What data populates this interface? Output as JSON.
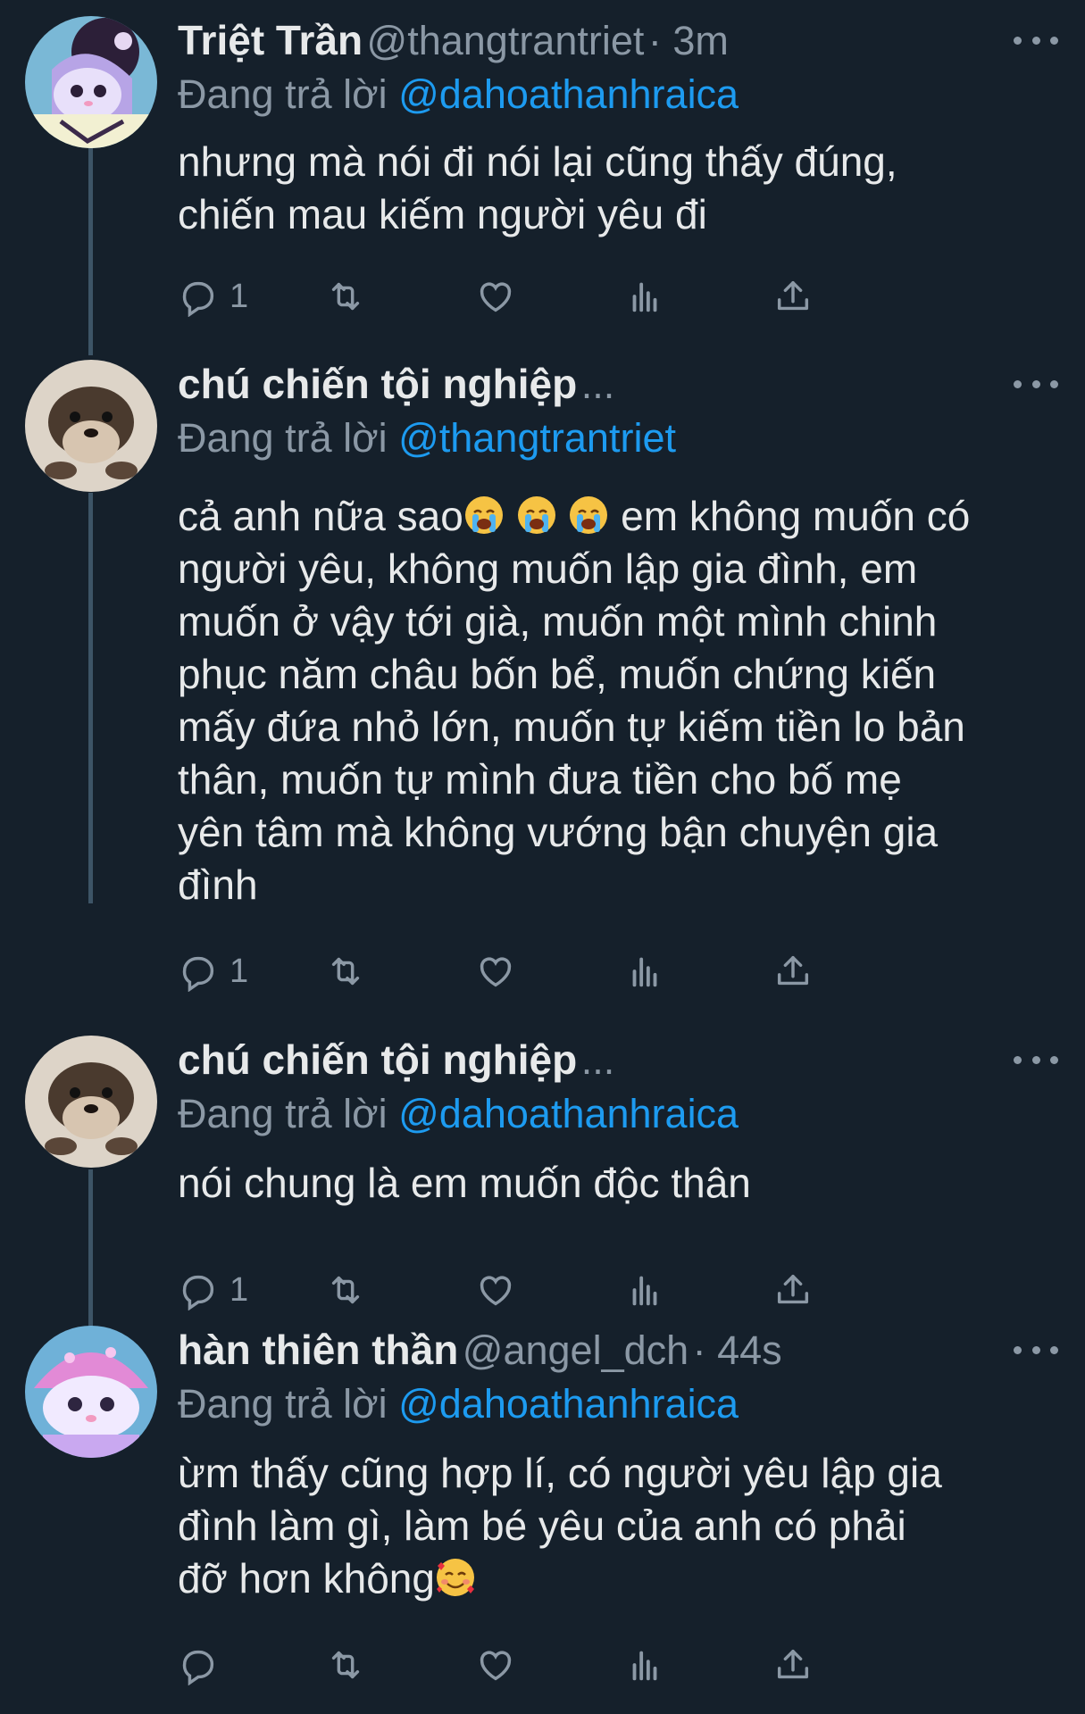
{
  "tweets": [
    {
      "name": "Triệt Trần",
      "handle": "@thangtrantriet",
      "time": "· 3m",
      "reply_prefix": "Đang trả lời",
      "reply_to": "@dahoathanhraica",
      "text_lines": [
        "nhưng mà nói đi nói lại cũng thấy đúng,",
        "chiến mau kiếm người yêu đi"
      ],
      "reply_count": "1",
      "avatar_icon": "kuromi-avatar-icon"
    },
    {
      "name": "chú chiến tội nghiệp",
      "name_suffix": "...",
      "reply_prefix": "Đang trả lời",
      "reply_to": "@thangtrantriet",
      "text_first": "cả anh nữa sao",
      "text_after_emoji": " em không muốn có",
      "text_lines": [
        "người yêu, không muốn lập gia đình, em",
        "muốn ở vậy tới già, muốn một mình chinh",
        "phục năm châu bốn bể, muốn chứng kiến",
        "mấy đứa nhỏ lớn, muốn tự kiếm tiền lo bản",
        "thân, muốn tự mình đưa tiền cho bố mẹ",
        "yên tâm mà không vướng bận chuyện gia",
        "đình"
      ],
      "emoji_icon": "crying-face-icon",
      "reply_count": "1",
      "avatar_icon": "otter-avatar-icon"
    },
    {
      "name": "chú chiến tội nghiệp",
      "name_suffix": "...",
      "reply_prefix": "Đang trả lời",
      "reply_to": "@dahoathanhraica",
      "text_lines": [
        "nói chung là em muốn độc thân"
      ],
      "reply_count": "1",
      "avatar_icon": "otter-avatar-icon"
    },
    {
      "name": "hàn thiên thần",
      "handle": "@angel_dch",
      "time": "· 44s",
      "reply_prefix": "Đang trả lời",
      "reply_to": "@dahoathanhraica",
      "text_lines": [
        "ừm thấy cũng hợp lí, có người yêu lập gia",
        "đình làm gì, làm bé yêu của anh có phải"
      ],
      "text_last": "đỡ hơn không",
      "emoji_icon": "smiling-face-with-hearts-icon",
      "reply_count": "",
      "avatar_icon": "my-melody-avatar-icon"
    }
  ],
  "colors": {
    "background": "#15202b",
    "text": "#e7e9ea",
    "secondary": "#8b98a5",
    "link": "#1d9bf0",
    "thread_line": "#3d5466"
  },
  "action_icons": [
    "reply-icon",
    "retweet-icon",
    "like-icon",
    "analytics-icon",
    "share-icon"
  ]
}
